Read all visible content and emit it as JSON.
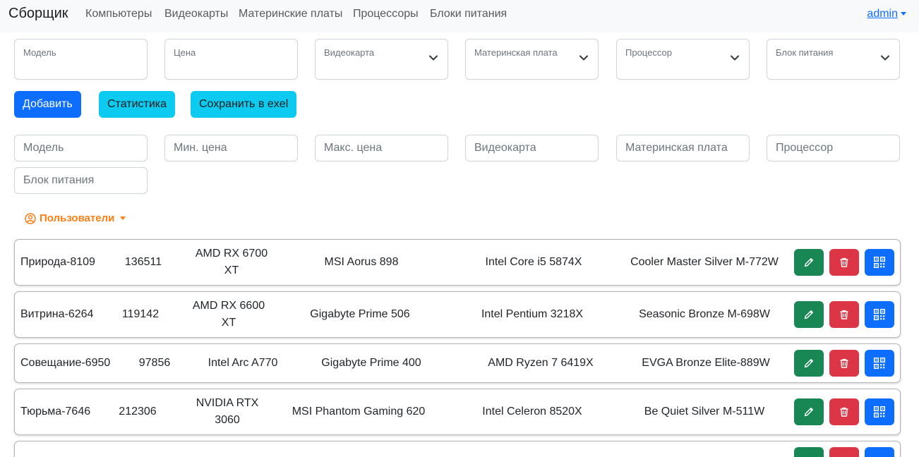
{
  "navbar": {
    "brand": "Сборщик",
    "links": [
      "Компьютеры",
      "Видеокарты",
      "Материнские платы",
      "Процессоры",
      "Блоки питания"
    ],
    "user": "admin"
  },
  "form": {
    "fields": [
      "Модель",
      "Цена",
      "Видеокарта",
      "Материнская плата",
      "Процессор",
      "Блок питания"
    ]
  },
  "buttons": {
    "add": "Добавить",
    "stats": "Статистика",
    "export": "Сохранить в exel"
  },
  "filters": {
    "model": "Модель",
    "min_price": "Мин. цена",
    "max_price": "Макс. цена",
    "gpu": "Видеокарта",
    "motherboard": "Материнская плата",
    "cpu": "Процессор",
    "psu": "Блок питания"
  },
  "users_menu": {
    "label": "Пользователи"
  },
  "colors": {
    "primary": "#0d6efd",
    "info": "#0dcaf0",
    "success": "#198754",
    "danger": "#dc3545",
    "users_accent": "#fd7e14"
  },
  "icons": {
    "edit": "pencil-icon",
    "delete": "trash-icon",
    "qr": "qr-code-icon",
    "user": "user-circle-icon",
    "select": "chevron-down-icon"
  },
  "computers": [
    {
      "model": "Природа-8109",
      "price": "136511",
      "gpu": "AMD RX 6700 XT",
      "motherboard": "MSI Aorus 898",
      "cpu": "Intel Core i5 5874X",
      "psu": "Cooler Master Silver M-772W"
    },
    {
      "model": "Витрина-6264",
      "price": "119142",
      "gpu": "AMD RX 6600 XT",
      "motherboard": "Gigabyte Prime 506",
      "cpu": "Intel Pentium 3218X",
      "psu": "Seasonic Bronze M-698W"
    },
    {
      "model": "Совещание-6950",
      "price": "97856",
      "gpu": "Intel Arc A770",
      "motherboard": "Gigabyte Prime 400",
      "cpu": "AMD Ryzen 7 6419X",
      "psu": "EVGA Bronze Elite-889W"
    },
    {
      "model": "Тюрьма-7646",
      "price": "212306",
      "gpu": "NVIDIA RTX 3060",
      "motherboard": "MSI Phantom Gaming 620",
      "cpu": "Intel Celeron 8520X",
      "psu": "Be Quiet Silver M-511W"
    }
  ]
}
